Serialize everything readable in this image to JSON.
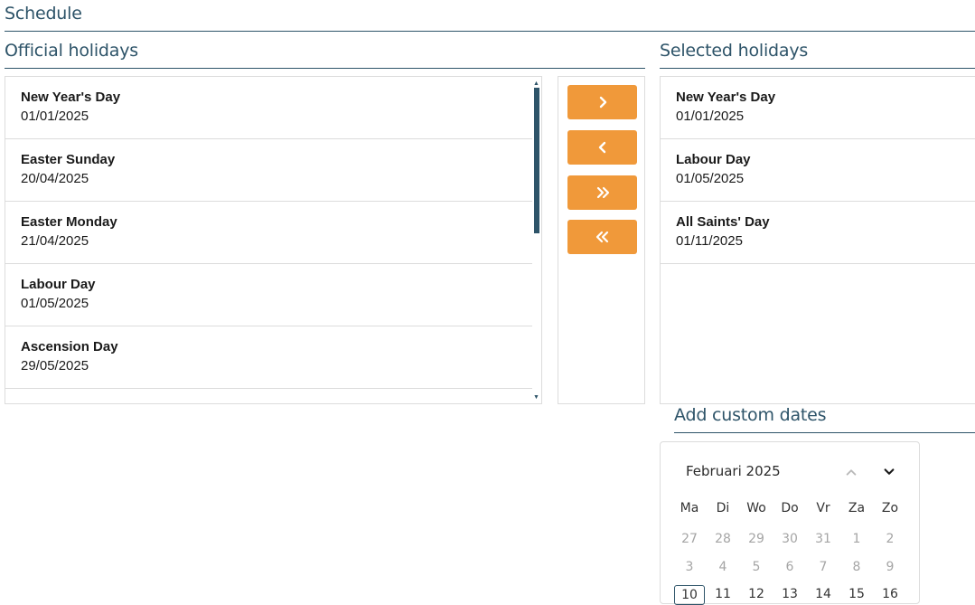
{
  "page": {
    "title": "Schedule"
  },
  "official": {
    "title": "Official holidays",
    "items": [
      {
        "name": "New Year's Day",
        "date": "01/01/2025"
      },
      {
        "name": "Easter Sunday",
        "date": "20/04/2025"
      },
      {
        "name": "Easter Monday",
        "date": "21/04/2025"
      },
      {
        "name": "Labour Day",
        "date": "01/05/2025"
      },
      {
        "name": "Ascension Day",
        "date": "29/05/2025"
      }
    ]
  },
  "transfer": {
    "icons": [
      "chevron-right-icon",
      "chevron-left-icon",
      "double-chevron-right-icon",
      "double-chevron-left-icon"
    ],
    "color": "#f0993a"
  },
  "selected": {
    "title": "Selected holidays",
    "items": [
      {
        "name": "New Year's Day",
        "date": "01/01/2025"
      },
      {
        "name": "Labour Day",
        "date": "01/05/2025"
      },
      {
        "name": "All Saints' Day",
        "date": "01/11/2025"
      }
    ]
  },
  "custom": {
    "title": "Add custom dates",
    "calendar": {
      "month": "Februari 2025",
      "weekdays": [
        "Ma",
        "Di",
        "Wo",
        "Do",
        "Vr",
        "Za",
        "Zo"
      ],
      "weeks": [
        [
          "27",
          "28",
          "29",
          "30",
          "31",
          "1",
          "2"
        ],
        [
          "3",
          "4",
          "5",
          "6",
          "7",
          "8",
          "9"
        ],
        [
          "10",
          "11",
          "12",
          "13",
          "14",
          "15",
          "16"
        ]
      ]
    }
  },
  "colors": {
    "accent": "#f0993a",
    "heading": "#2e5469",
    "border": "#dcdcdc"
  }
}
